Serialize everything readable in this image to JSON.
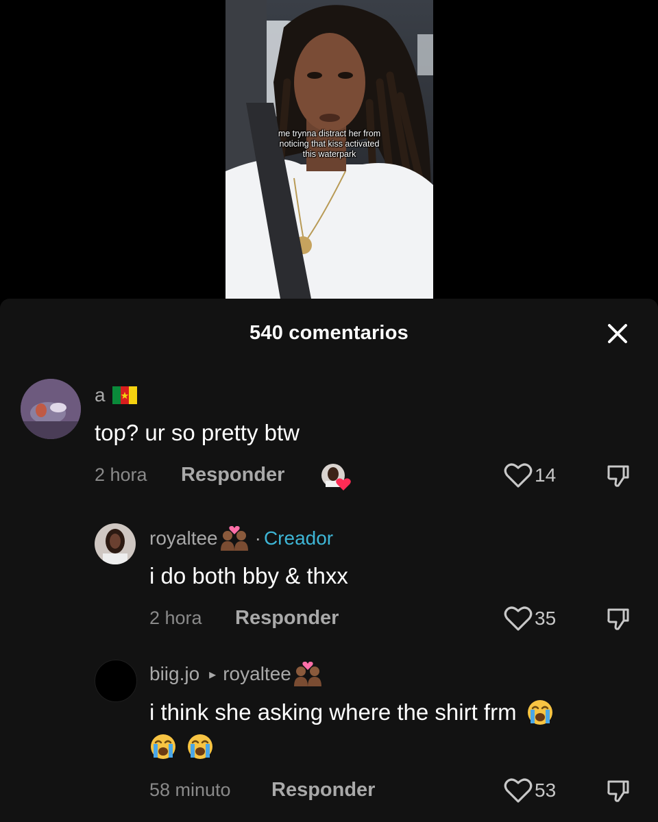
{
  "video": {
    "caption_lines": [
      "me trynna distract her from",
      "noticing that kiss activated",
      "this waterpark"
    ]
  },
  "sheet": {
    "title": "540 comentarios"
  },
  "comments": [
    {
      "username": "a",
      "flag": "cameroon-flag",
      "text": "top? ur so pretty btw",
      "time": "2 hora",
      "reply_label": "Responder",
      "likes": "14",
      "liked_by_creator": true
    },
    {
      "username": "royaltee",
      "badge": "two-people-heart-emoji",
      "separator": "·",
      "creator_label": "Creador",
      "text": "i do both bby & thxx",
      "time": "2 hora",
      "reply_label": "Responder",
      "likes": "35"
    },
    {
      "username": "biig.jo",
      "reply_to_arrow": "▸",
      "reply_to": "royaltee",
      "badge": "two-people-heart-emoji",
      "text_line1": "i think she asking where the shirt frm",
      "trailing_emoji": "crying-face",
      "text_line2_emoji_count": 2,
      "time": "58 minuto",
      "reply_label": "Responder",
      "likes": "53"
    }
  ],
  "colors": {
    "sheet_bg": "#121212",
    "creator": "#3eb6d6",
    "muted": "#8a8a8a"
  }
}
